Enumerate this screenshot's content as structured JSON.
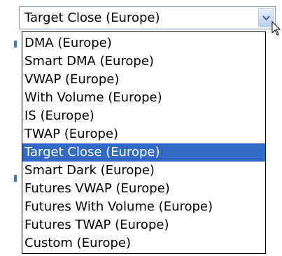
{
  "combobox": {
    "value": "Target Close (Europe)",
    "button_icon": "chevron-down-icon"
  },
  "dropdown": {
    "selected_index": 6,
    "items": [
      {
        "label": "DMA (Europe)"
      },
      {
        "label": "Smart DMA (Europe)"
      },
      {
        "label": "VWAP (Europe)"
      },
      {
        "label": "With Volume (Europe)"
      },
      {
        "label": "IS (Europe)"
      },
      {
        "label": "TWAP (Europe)"
      },
      {
        "label": "Target Close (Europe)"
      },
      {
        "label": "Smart Dark (Europe)"
      },
      {
        "label": "Futures VWAP (Europe)"
      },
      {
        "label": "Futures With Volume (Europe)"
      },
      {
        "label": "Futures TWAP (Europe)"
      },
      {
        "label": "Custom (Europe)"
      }
    ]
  },
  "colors": {
    "selection_bg": "#316ac5",
    "selection_text": "#ffffff",
    "border": "#7f9db9"
  }
}
